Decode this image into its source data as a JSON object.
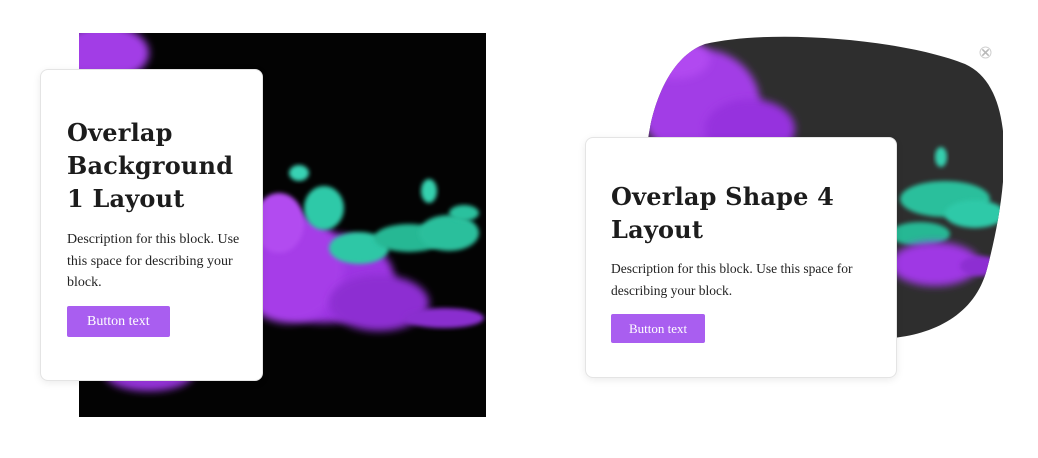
{
  "blocks": [
    {
      "title": "Overlap Background 1 Layout",
      "description": "Description for this block. Use this space for describing your block.",
      "button_label": "Button text",
      "image": "purple-teal-ink-cloud-on-black"
    },
    {
      "title": "Overlap Shape 4 Layout",
      "description": "Description for this block. Use this space for describing your block.",
      "button_label": "Button text",
      "image": "purple-teal-ink-cloud-blob-shape"
    }
  ],
  "icons": {
    "close": "close-icon"
  },
  "colors": {
    "button": "#a95ef0",
    "ink_purple": "#a23ce6",
    "ink_teal": "#2fc9a8",
    "image_background": "#030303",
    "shape_background": "#2e2e2e"
  }
}
